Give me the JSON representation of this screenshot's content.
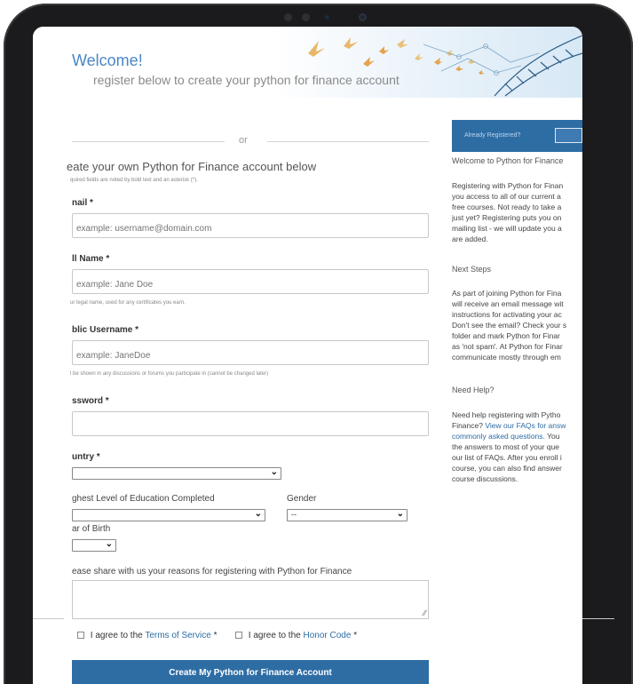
{
  "hero": {
    "title": "Welcome!",
    "subtitle": "register below to create your python for finance account"
  },
  "form": {
    "or_label": "or",
    "section_title": "eate your own Python for Finance account below",
    "required_note": "quired fields are noted by bold text and an asterisk (*).",
    "email": {
      "label": "nail *",
      "placeholder": "example: username@domain.com"
    },
    "full_name": {
      "label": "ll Name *",
      "placeholder": "example: Jane Doe",
      "help": "ur legal name, used for any certificates you earn."
    },
    "username": {
      "label": "blic Username *",
      "placeholder": "example: JaneDoe",
      "help": "l be shown in any discussions or forums you participate in (cannot be changed later)"
    },
    "password": {
      "label": "ssword *"
    },
    "country": {
      "label": "untry *",
      "value": ""
    },
    "education": {
      "label": "ghest Level of Education Completed",
      "value": ""
    },
    "gender": {
      "label": "Gender",
      "value": "--"
    },
    "birth_year": {
      "label": "ar of Birth",
      "value": ""
    },
    "reasons": {
      "label": "ease share with us your reasons for registering with Python for Finance"
    },
    "agree_tos_prefix": "I agree to the",
    "agree_tos_link": "Terms of Service",
    "agree_tos_suffix": "*",
    "agree_honor_prefix": "I agree to the",
    "agree_honor_link": "Honor Code",
    "agree_honor_suffix": "*",
    "submit_label": "Create My Python for Finance Account"
  },
  "sidebar": {
    "already_registered": "Already Registered?",
    "welcome_heading": "Welcome to Python for Finance",
    "welcome_body": [
      "Registering with Python for Finan",
      "you access to all of our current a",
      "free courses. Not ready to take a",
      "just yet? Registering puts you on",
      "mailing list - we will update you a",
      "are added."
    ],
    "next_steps_heading": "Next Steps",
    "next_steps_body": [
      "As part of joining Python for Fina",
      "will receive an email message wit",
      "instructions for activating your ac",
      "Don't see the email? Check your s",
      "folder and mark Python for Finar",
      "as 'not spam'. At Python for Finar",
      "communicate mostly through em"
    ],
    "help_heading": "Need Help?",
    "help_line1": "Need help registering with Pytho",
    "help_line2_prefix": "Finance?",
    "help_line2_link": "View our FAQs for answ",
    "help_line3_link": "commonly asked questions.",
    "help_line3_suffix": "You",
    "help_rest": [
      "the answers to most of your que",
      "our list of FAQs. After you enroll i",
      "course, you can also find answer",
      "course discussions."
    ]
  },
  "colors": {
    "accent": "#2e6da4",
    "title_blue": "#4a86c5",
    "device_frame": "#1b1b1d"
  }
}
